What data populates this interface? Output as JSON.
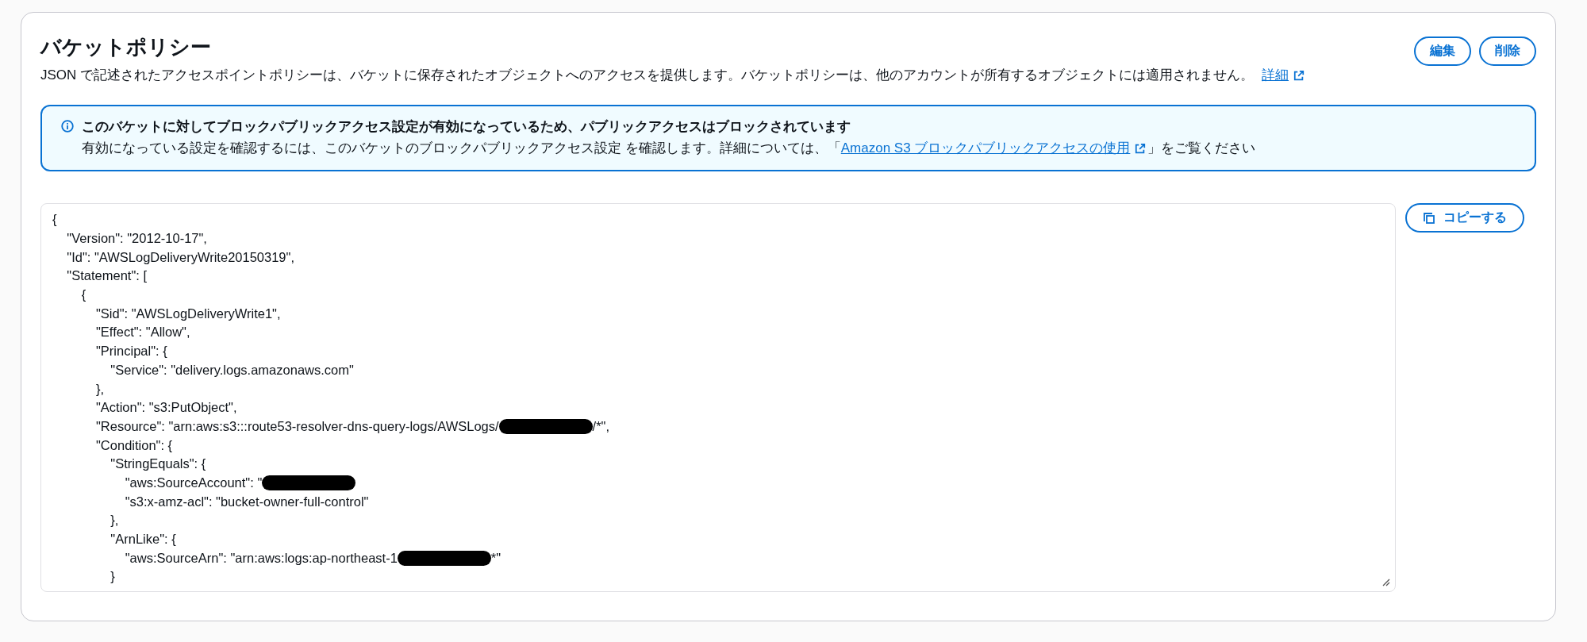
{
  "panel": {
    "title": "バケットポリシー",
    "description": "JSON で記述されたアクセスポイントポリシーは、バケットに保存されたオブジェクトへのアクセスを提供します。バケットポリシーは、他のアカウントが所有するオブジェクトには適用されません。",
    "details_link": "詳細",
    "buttons": [
      "編集",
      "削除"
    ]
  },
  "alert": {
    "title": "このバケットに対してブロックパブリックアクセス設定が有効になっているため、パブリックアクセスはブロックされています",
    "text_before": "有効になっている設定を確認するには、このバケットのブロックパブリックアクセス設定 を確認します。詳細については、「",
    "link": "Amazon S3 ブロックパブリックアクセスの使用",
    "text_after": "」をご覧ください"
  },
  "policy_editor": {
    "lines": [
      {
        "text": "{"
      },
      {
        "text": "    \"Version\": \"2012-10-17\","
      },
      {
        "text": "    \"Id\": \"AWSLogDeliveryWrite20150319\","
      },
      {
        "text": "    \"Statement\": ["
      },
      {
        "text": "        {"
      },
      {
        "text": "            \"Sid\": \"AWSLogDeliveryWrite1\","
      },
      {
        "text": "            \"Effect\": \"Allow\","
      },
      {
        "text": "            \"Principal\": {"
      },
      {
        "text": "                \"Service\": \"delivery.logs.amazonaws.com\""
      },
      {
        "text": "            },"
      },
      {
        "text": "            \"Action\": \"s3:PutObject\","
      },
      {
        "text": "            \"Resource\": \"arn:aws:s3:::route53-resolver-dns-query-logs/AWSLogs/",
        "redacted": true,
        "after": "/*\","
      },
      {
        "text": "            \"Condition\": {"
      },
      {
        "text": "                \"StringEquals\": {"
      },
      {
        "text": "                    \"aws:SourceAccount\": \"",
        "redacted": true
      },
      {
        "text": "                    \"s3:x-amz-acl\": \"bucket-owner-full-control\""
      },
      {
        "text": "                },"
      },
      {
        "text": "                \"ArnLike\": {"
      },
      {
        "text": "                    \"aws:SourceArn\": \"arn:aws:logs:ap-northeast-1",
        "redacted": true,
        "after": "*\""
      },
      {
        "text": "                }"
      }
    ],
    "copy_button": "コピーする"
  }
}
